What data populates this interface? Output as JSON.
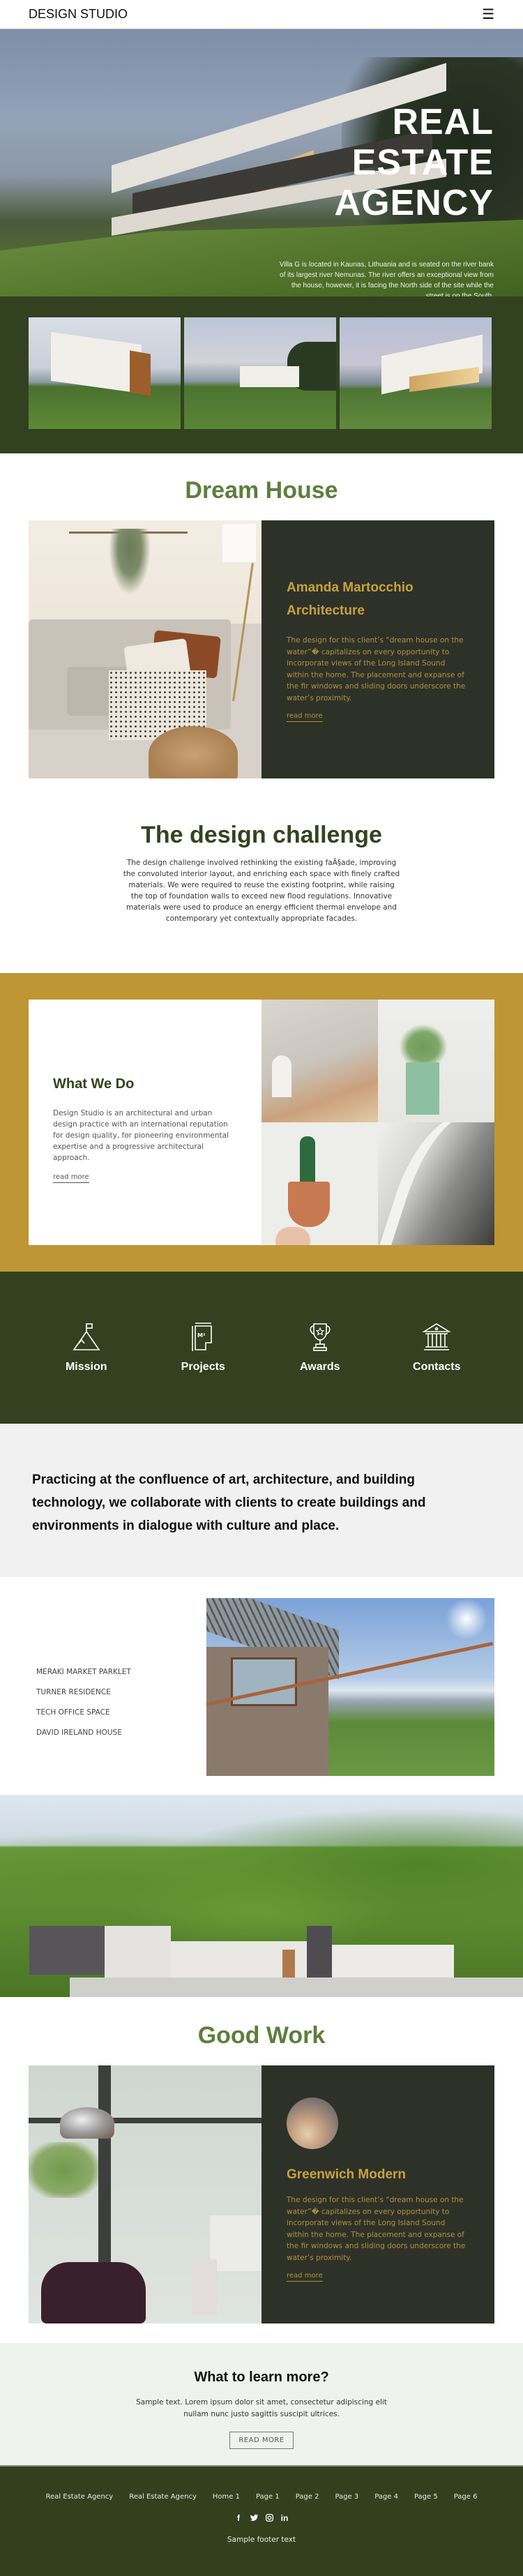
{
  "header": {
    "logo": "DESIGN STUDIO",
    "menu_icon": "hamburger-icon",
    "menu_glyph": "☰"
  },
  "hero": {
    "title_lines": [
      "REAL",
      "ESTATE",
      "AGENCY"
    ],
    "description": "Villa G is located in Kaunas, Lithuania and is seated on the river bank of its largest river Nemunas. The river offers an exceptional view from the house, however, it is facing the North side of the site while the street is on the South."
  },
  "gallery": {
    "images": [
      "villa-side-view",
      "villa-lawn-view",
      "villa-evening-view"
    ]
  },
  "dream_house": {
    "title": "Dream House",
    "card": {
      "title": "Amanda Martocchio Architecture",
      "text": "The design for this client’s “dream house on the water”� capitalizes on every opportunity to incorporate views of the Long Island Sound within the home. The placement and expanse of the fir windows and sliding doors underscore the water’s proximity.",
      "link": "read more"
    }
  },
  "challenge": {
    "title": "The design challenge",
    "text": "The design challenge involved rethinking the existing faÃ§ade, improving the convoluted interior layout, and enriching each space with finely crafted materials. We were required to reuse the existing footprint, while raising the top of foundation walls to exceed new flood regulations. Innovative materials were used to produce an energy efficient thermal envelope and contemporary yet contextually appropriate facades."
  },
  "what_we_do": {
    "title": "What We Do",
    "text": "Design Studio is an architectural and urban design practice with an international reputation for design quality, for pioneering environmental expertise and a progressive architectural approach.",
    "link": "read more"
  },
  "features": [
    {
      "label": "Mission",
      "icon": "mountain-flag-icon"
    },
    {
      "label": "Projects",
      "icon": "floor-plan-icon"
    },
    {
      "label": "Awards",
      "icon": "trophy-icon"
    },
    {
      "label": "Contacts",
      "icon": "bank-building-icon"
    }
  ],
  "quote": {
    "text": "Practicing at the confluence of art, architecture, and building technology, we collaborate with clients to create buildings and environments in dialogue with culture and place."
  },
  "projects": {
    "items": [
      "MERAKI MARKET PARKLET",
      "TURNER RESIDENCE",
      "TECH OFFICE SPACE",
      "DAVID IRELAND HOUSE"
    ]
  },
  "good_work": {
    "title": "Good Work",
    "card": {
      "title": "Greenwich Modern",
      "text": "The design for this client’s “dream house on the water”� capitalizes on every opportunity to incorporate views of the Long Island Sound within the home. The placement and expanse of the fir windows and sliding doors underscore the water’s proximity.",
      "link": "read more"
    }
  },
  "cta": {
    "title": "What to learn more?",
    "text": "Sample text. Lorem ipsum dolor sit amet, consectetur adipiscing elit nullam nunc justo sagittis suscipit ultrices.",
    "button": "READ MORE"
  },
  "footer": {
    "links": [
      "Real Estate Agency",
      "Real Estate Agency",
      "Home 1",
      "Page 1",
      "Page 2",
      "Page 3",
      "Page 4",
      "Page 5",
      "Page 6"
    ],
    "socials": [
      {
        "name": "facebook-icon",
        "glyph": "f"
      },
      {
        "name": "twitter-icon",
        "glyph": "🐦"
      },
      {
        "name": "instagram-icon",
        "glyph": "◎"
      },
      {
        "name": "linkedin-icon",
        "glyph": "in"
      }
    ],
    "text": "Sample footer text"
  },
  "colors": {
    "dark_green": "#34401f",
    "olive_title": "#5e7e3c",
    "gold": "#bf9634",
    "card_dark": "#2d3128",
    "card_gold_text": "#c8a23e"
  }
}
